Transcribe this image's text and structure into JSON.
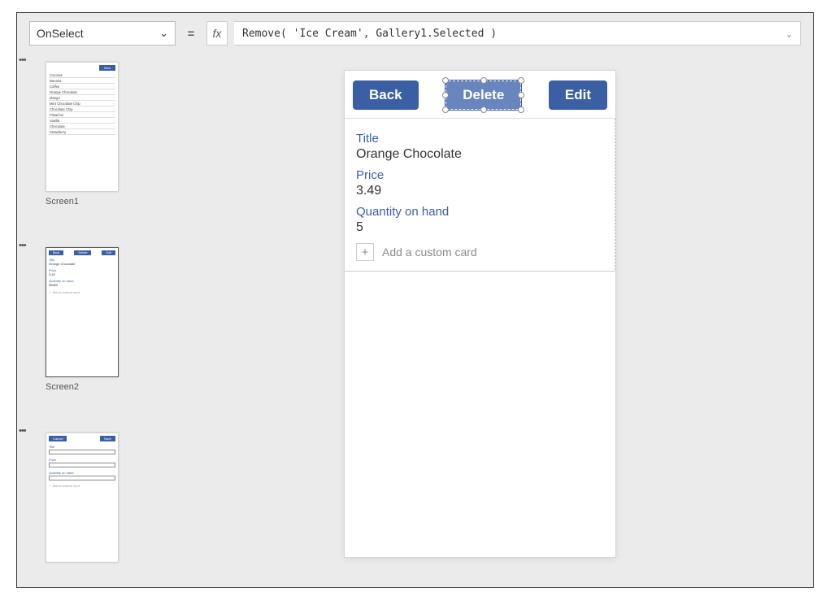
{
  "formula_bar": {
    "property": "OnSelect",
    "fx_label": "fx",
    "equals": "=",
    "formula": "Remove( 'Ice Cream', Gallery1.Selected )"
  },
  "thumbnails": {
    "screen1": {
      "name": "Screen1",
      "new_label": "New",
      "items": [
        "Coconut",
        "Banana",
        "Coffee",
        "Orange Chocolate",
        "Mango",
        "Mint Chocolate Chip",
        "Chocolate Chip",
        "Pistachio",
        "Vanilla",
        "Chocolate",
        "Strawberry"
      ]
    },
    "screen2": {
      "name": "Screen2",
      "buttons": {
        "back": "Back",
        "delete": "Delete",
        "edit": "Edit"
      },
      "fields": {
        "title_lbl": "Title",
        "title_val": "Orange Chocolate",
        "price_lbl": "Price",
        "price_val": "3.49",
        "qty_lbl": "Quantity on hand",
        "qty_val": "56650"
      },
      "add_card": "Add a custom card"
    },
    "screen3": {
      "buttons": {
        "cancel": "Cancel",
        "save": "Save"
      },
      "fields": {
        "title_lbl": "Title",
        "price_lbl": "Price",
        "qty_lbl": "Quantity on hand"
      },
      "add_card": "Add a custom card"
    }
  },
  "canvas": {
    "buttons": {
      "back": "Back",
      "delete": "Delete",
      "edit": "Edit"
    },
    "fields": {
      "title_lbl": "Title",
      "title_val": "Orange Chocolate",
      "price_lbl": "Price",
      "price_val": "3.49",
      "qty_lbl": "Quantity on hand",
      "qty_val": "5"
    },
    "add_card": "Add a custom card"
  }
}
